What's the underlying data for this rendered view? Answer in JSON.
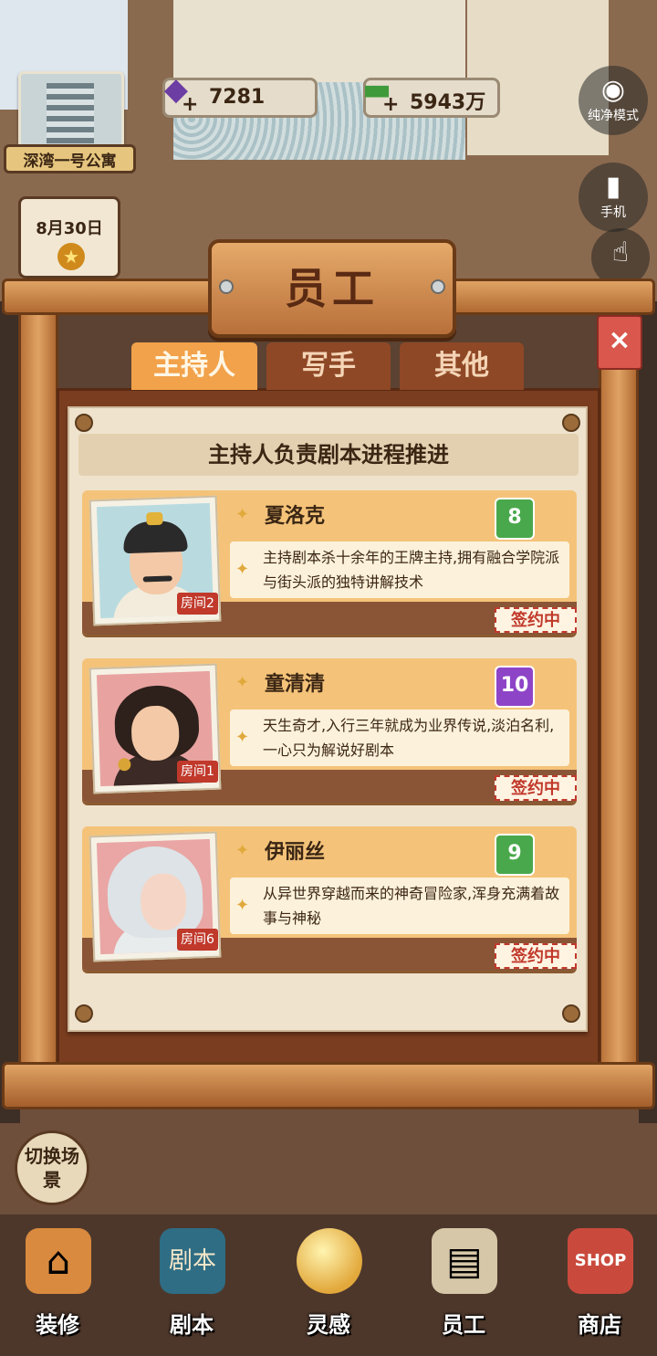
{
  "hud": {
    "apartment_name": "深湾一号公寓",
    "date": "8月30日",
    "gems": {
      "value": "7281",
      "plus": "+"
    },
    "money": {
      "value": "5943万",
      "plus": "+"
    },
    "pure_mode_label": "纯净模式",
    "phone_label": "手机"
  },
  "panel": {
    "title": "员工",
    "close": "×",
    "tabs": [
      {
        "label": "主持人",
        "active": true
      },
      {
        "label": "写手",
        "active": false
      },
      {
        "label": "其他",
        "active": false
      }
    ],
    "header": "主持人负责剧本进程推进",
    "staff": [
      {
        "name": "夏洛克",
        "level": "8",
        "room": "房间2",
        "desc": "主持剧本杀十余年的王牌主持,拥有融合学院派与街头派的独特讲解技术",
        "status": "签约中"
      },
      {
        "name": "童清清",
        "level": "10",
        "room": "房间1",
        "desc": "天生奇才,入行三年就成为业界传说,淡泊名利,一心只为解说好剧本",
        "status": "签约中"
      },
      {
        "name": "伊丽丝",
        "level": "9",
        "room": "房间6",
        "desc": "从异世界穿越而来的神奇冒险家,浑身充满着故事与神秘",
        "status": "签约中"
      }
    ]
  },
  "switch_scene": "切换场景",
  "nav": {
    "decor": "装修",
    "script": "剧本",
    "script_icon_text": "剧本",
    "inspiration": "灵感",
    "staff": "员工",
    "shop": "商店",
    "shop_icon_text": "SHOP"
  },
  "colors": {
    "tab_active": "#f2a24a",
    "tab_inactive": "#8f4826",
    "card": "#f4c379",
    "sign_red": "#c0392b",
    "level_green": "#49a84b",
    "level_purple": "#8e44c7"
  }
}
